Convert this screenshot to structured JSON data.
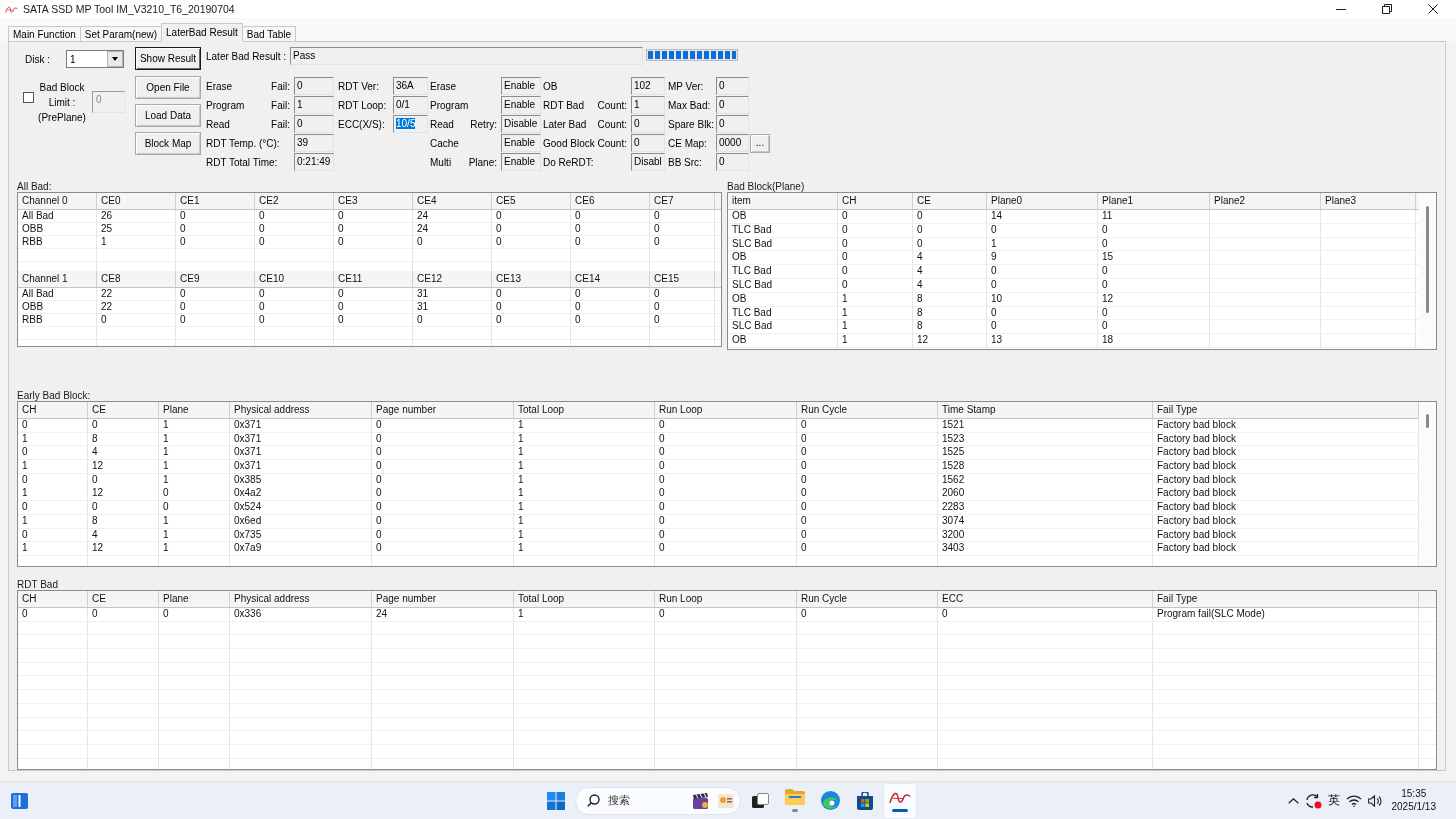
{
  "window": {
    "title": "SATA SSD MP Tool IM_V3210_T6_20190704"
  },
  "tabs": [
    {
      "label": "Main Function",
      "selected": false
    },
    {
      "label": "Set Param(new)",
      "selected": false
    },
    {
      "label": "LaterBad Result",
      "selected": true
    },
    {
      "label": "Bad Table",
      "selected": false
    }
  ],
  "disk": {
    "label": "Disk :",
    "value": "1"
  },
  "buttons": [
    {
      "label": "Show Result",
      "default": true
    },
    {
      "label": "Open File",
      "default": false
    },
    {
      "label": "Load Data",
      "default": false
    },
    {
      "label": "Block Map",
      "default": false
    }
  ],
  "later_bad_result": {
    "label": "Later Bad Result :",
    "value": "Pass",
    "level": 1
  },
  "bad_block_limit": {
    "checked": false,
    "label_lines": [
      "Bad Block",
      "Limit :",
      "(PrePlane)"
    ],
    "value": "0",
    "disabled": true
  },
  "stats": [
    [
      {
        "label": "Erase",
        "label_2": "Fail:",
        "value": "0",
        "selected": false
      },
      {
        "label": "Program",
        "label_2": "Fail:",
        "value": "1",
        "selected": false
      },
      {
        "label": "Read",
        "label_2": "Fail:",
        "value": "0",
        "selected": false
      },
      {
        "label": "RDT Temp. (°C):",
        "value": "39",
        "selected": false
      },
      {
        "label": "RDT Total Time:",
        "value": "0:21:49",
        "selected": false
      }
    ],
    [
      {
        "label": "RDT Ver:",
        "value": "36A",
        "selected": false
      },
      {
        "label": "RDT Loop:",
        "value": "0/1",
        "selected": false
      },
      {
        "label": "ECC(X/S):",
        "value": "10/5",
        "selected": true
      }
    ],
    [
      {
        "label": "Erase",
        "value": "Enable",
        "selected": false
      },
      {
        "label": "Program",
        "value": "Enable",
        "selected": false
      },
      {
        "label": "Read",
        "label_2": "Retry:",
        "value": "Disable",
        "selected": false
      },
      {
        "label": "Cache",
        "value": "Enable",
        "selected": false
      },
      {
        "label": "Multi",
        "label_2": "Plane:",
        "value": "Enable",
        "selected": false
      }
    ],
    [
      {
        "label": "OB",
        "value": "102",
        "selected": false
      },
      {
        "label": "RDT Bad",
        "label_2": "Count:",
        "value": "1",
        "selected": false
      },
      {
        "label": "Later Bad",
        "label_2": "Count:",
        "value": "0",
        "selected": false
      },
      {
        "label": "Good Block Count:",
        "value": "0",
        "selected": false
      },
      {
        "label": "Do ReRDT:",
        "value": "Disabl",
        "selected": false
      }
    ],
    [
      {
        "label": "MP Ver:",
        "value": "0",
        "selected": false
      },
      {
        "label": "Max Bad:",
        "value": "0",
        "selected": false
      },
      {
        "label": "Spare Blk:",
        "value": "0",
        "selected": false
      },
      {
        "label": "CE Map:",
        "value": "0000",
        "button": "...",
        "selected": false
      },
      {
        "label": "BB Src:",
        "value": "0",
        "selected": false
      }
    ]
  ],
  "all_bad": {
    "label": "All Bad:",
    "groups": [
      {
        "columns": [
          "Channel 0",
          "CE0",
          "CE1",
          "CE2",
          "CE3",
          "CE4",
          "CE5",
          "CE6",
          "CE7"
        ],
        "rows": [
          [
            "All Bad",
            "26",
            "0",
            "0",
            "0",
            "24",
            "0",
            "0",
            "0"
          ],
          [
            "OBB",
            "25",
            "0",
            "0",
            "0",
            "24",
            "0",
            "0",
            "0"
          ],
          [
            "RBB",
            "1",
            "0",
            "0",
            "0",
            "0",
            "0",
            "0",
            "0"
          ]
        ]
      },
      {
        "columns": [
          "Channel 1",
          "CE8",
          "CE9",
          "CE10",
          "CE11",
          "CE12",
          "CE13",
          "CE14",
          "CE15"
        ],
        "rows": [
          [
            "All Bad",
            "22",
            "0",
            "0",
            "0",
            "31",
            "0",
            "0",
            "0"
          ],
          [
            "OBB",
            "22",
            "0",
            "0",
            "0",
            "31",
            "0",
            "0",
            "0"
          ],
          [
            "RBB",
            "0",
            "0",
            "0",
            "0",
            "0",
            "0",
            "0",
            "0"
          ]
        ]
      }
    ]
  },
  "bad_block_plane": {
    "label": "Bad Block(Plane)",
    "columns": [
      "item",
      "CH",
      "CE",
      "Plane0",
      "Plane1",
      "Plane2",
      "Plane3"
    ],
    "rows": [
      [
        "OB",
        "0",
        "0",
        "14",
        "11"
      ],
      [
        "TLC Bad",
        "0",
        "0",
        "0",
        "0"
      ],
      [
        "SLC Bad",
        "0",
        "0",
        "1",
        "0"
      ],
      [
        "OB",
        "0",
        "4",
        "9",
        "15"
      ],
      [
        "TLC Bad",
        "0",
        "4",
        "0",
        "0"
      ],
      [
        "SLC Bad",
        "0",
        "4",
        "0",
        "0"
      ],
      [
        "OB",
        "1",
        "8",
        "10",
        "12"
      ],
      [
        "TLC Bad",
        "1",
        "8",
        "0",
        "0"
      ],
      [
        "SLC Bad",
        "1",
        "8",
        "0",
        "0"
      ],
      [
        "OB",
        "1",
        "12",
        "13",
        "18"
      ]
    ]
  },
  "early_bad_block": {
    "label": "Early Bad Block:",
    "columns": [
      "CH",
      "CE",
      "Plane",
      "Physical address",
      "Page number",
      "Total Loop",
      "Run Loop",
      "Run Cycle",
      "Time Stamp",
      "Fail Type"
    ],
    "rows": [
      [
        "0",
        "0",
        "1",
        "0x371",
        "0",
        "1",
        "0",
        "0",
        "1521",
        "Factory bad block"
      ],
      [
        "1",
        "8",
        "1",
        "0x371",
        "0",
        "1",
        "0",
        "0",
        "1523",
        "Factory bad block"
      ],
      [
        "0",
        "4",
        "1",
        "0x371",
        "0",
        "1",
        "0",
        "0",
        "1525",
        "Factory bad block"
      ],
      [
        "1",
        "12",
        "1",
        "0x371",
        "0",
        "1",
        "0",
        "0",
        "1528",
        "Factory bad block"
      ],
      [
        "0",
        "0",
        "1",
        "0x385",
        "0",
        "1",
        "0",
        "0",
        "1562",
        "Factory bad block"
      ],
      [
        "1",
        "12",
        "0",
        "0x4a2",
        "0",
        "1",
        "0",
        "0",
        "2060",
        "Factory bad block"
      ],
      [
        "0",
        "0",
        "0",
        "0x524",
        "0",
        "1",
        "0",
        "0",
        "2283",
        "Factory bad block"
      ],
      [
        "1",
        "8",
        "1",
        "0x6ed",
        "0",
        "1",
        "0",
        "0",
        "3074",
        "Factory bad block"
      ],
      [
        "0",
        "4",
        "1",
        "0x735",
        "0",
        "1",
        "0",
        "0",
        "3200",
        "Factory bad block"
      ],
      [
        "1",
        "12",
        "1",
        "0x7a9",
        "0",
        "1",
        "0",
        "0",
        "3403",
        "Factory bad block"
      ]
    ]
  },
  "rdt_bad": {
    "label": "RDT Bad",
    "columns": [
      "CH",
      "CE",
      "Plane",
      "Physical address",
      "Page number",
      "Total Loop",
      "Run Loop",
      "Run Cycle",
      "ECC",
      "Fail Type"
    ],
    "rows": [
      [
        "0",
        "0",
        "0",
        "0x336",
        "24",
        "1",
        "0",
        "0",
        "0",
        "Program fail(SLC Mode)"
      ]
    ]
  },
  "taskbar": {
    "search": {
      "placeholder": "搜索"
    },
    "apps": [
      {
        "kind": "task-view",
        "running": false,
        "selected": false
      },
      {
        "kind": "folder",
        "running": true,
        "selected": false
      },
      {
        "kind": "browser",
        "running": false,
        "selected": false
      },
      {
        "kind": "store",
        "running": false,
        "selected": false
      },
      {
        "kind": "tool",
        "running": true,
        "selected": true
      }
    ],
    "tray": {
      "ime": "英",
      "time": "15:35",
      "date": "2025/1/13"
    }
  }
}
